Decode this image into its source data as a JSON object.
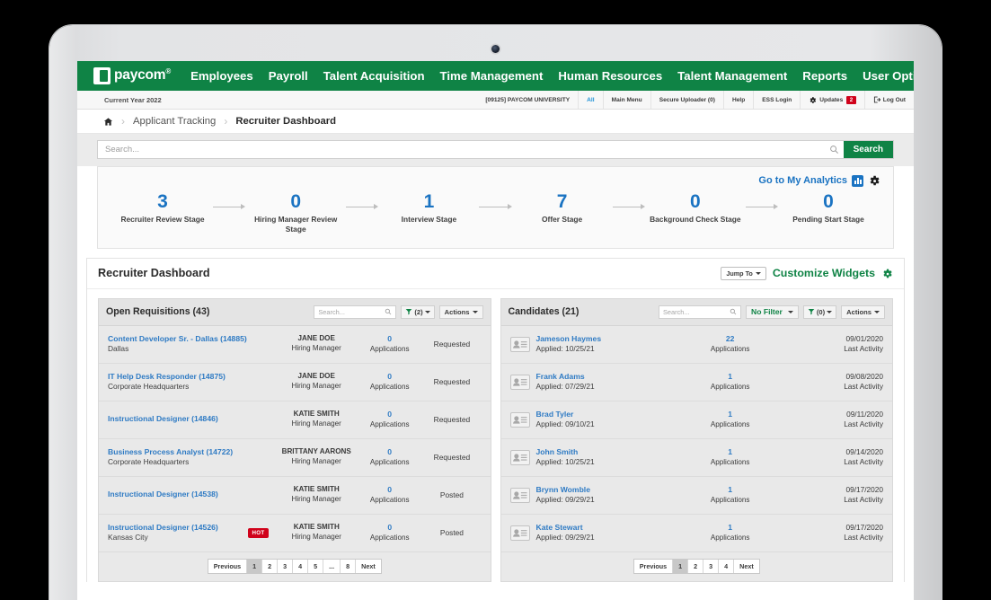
{
  "topnav": {
    "brand": "paycom",
    "brand_tm": "®",
    "items": [
      {
        "label": "Employees"
      },
      {
        "label": "Payroll"
      },
      {
        "label": "Talent Acquisition"
      },
      {
        "label": "Time Management"
      },
      {
        "label": "Human Resources"
      },
      {
        "label": "Talent Management"
      },
      {
        "label": "Reports"
      },
      {
        "label": "User Options"
      }
    ]
  },
  "utilbar": {
    "current_year": "Current Year 2022",
    "client": "[09125] PAYCOM UNIVERSITY",
    "all": "All",
    "main_menu": "Main Menu",
    "secure_uploader": "Secure Uploader (0)",
    "help": "Help",
    "ess_login": "ESS Login",
    "updates": "Updates",
    "updates_count": "2",
    "log_out": "Log Out"
  },
  "breadcrumb": {
    "home_icon": "home-icon",
    "items": [
      "Applicant Tracking",
      "Recruiter Dashboard"
    ]
  },
  "search": {
    "placeholder": "Search...",
    "value": "",
    "button_label": "Search"
  },
  "pipeline": {
    "analytics_link": "Go to My Analytics",
    "stages": [
      {
        "count": "3",
        "label": "Recruiter Review Stage"
      },
      {
        "count": "0",
        "label": "Hiring Manager Review Stage"
      },
      {
        "count": "1",
        "label": "Interview Stage"
      },
      {
        "count": "7",
        "label": "Offer Stage"
      },
      {
        "count": "0",
        "label": "Background Check Stage"
      },
      {
        "count": "0",
        "label": "Pending Start Stage"
      }
    ]
  },
  "dashboard": {
    "title": "Recruiter Dashboard",
    "jump_to": "Jump To",
    "customize_widgets": "Customize Widgets"
  },
  "requisitions": {
    "title": "Open Requisitions (43)",
    "search_placeholder": "Search...",
    "filter_label": "(2)",
    "actions_label": "Actions",
    "rows": [
      {
        "title": "Content Developer Sr. - Dallas (14885)",
        "location": "Dallas",
        "hot": "",
        "manager": "JANE DOE",
        "role": "Hiring Manager",
        "apps": "0",
        "apps_label": "Applications",
        "status": "Requested"
      },
      {
        "title": "IT Help Desk Responder (14875)",
        "location": "Corporate Headquarters",
        "hot": "",
        "manager": "JANE DOE",
        "role": "Hiring Manager",
        "apps": "0",
        "apps_label": "Applications",
        "status": "Requested"
      },
      {
        "title": "Instructional Designer (14846)",
        "location": "",
        "hot": "",
        "manager": "KATIE SMITH",
        "role": "Hiring Manager",
        "apps": "0",
        "apps_label": "Applications",
        "status": "Requested"
      },
      {
        "title": "Business Process Analyst (14722)",
        "location": "Corporate Headquarters",
        "hot": "",
        "manager": "BRITTANY AARONS",
        "role": "Hiring Manager",
        "apps": "0",
        "apps_label": "Applications",
        "status": "Requested"
      },
      {
        "title": "Instructional Designer (14538)",
        "location": "",
        "hot": "",
        "manager": "KATIE SMITH",
        "role": "Hiring Manager",
        "apps": "0",
        "apps_label": "Applications",
        "status": "Posted"
      },
      {
        "title": "Instructional Designer (14526)",
        "location": "Kansas City",
        "hot": "HOT",
        "manager": "KATIE SMITH",
        "role": "Hiring Manager",
        "apps": "0",
        "apps_label": "Applications",
        "status": "Posted"
      }
    ],
    "pager": [
      "Previous",
      "1",
      "2",
      "3",
      "4",
      "5",
      "...",
      "8",
      "Next"
    ],
    "pager_active": "1"
  },
  "candidates": {
    "title": "Candidates (21)",
    "search_placeholder": "Search...",
    "no_filter_label": "No Filter",
    "filter_label": "(0)",
    "actions_label": "Actions",
    "rows": [
      {
        "name": "Jameson Haymes",
        "applied": "Applied: 10/25/21",
        "apps": "22",
        "apps_label": "Applications",
        "date": "09/01/2020",
        "date_label": "Last Activity"
      },
      {
        "name": "Frank Adams",
        "applied": "Applied: 07/29/21",
        "apps": "1",
        "apps_label": "Applications",
        "date": "09/08/2020",
        "date_label": "Last Activity"
      },
      {
        "name": "Brad Tyler",
        "applied": "Applied: 09/10/21",
        "apps": "1",
        "apps_label": "Applications",
        "date": "09/11/2020",
        "date_label": "Last Activity"
      },
      {
        "name": "John Smith",
        "applied": "Applied: 10/25/21",
        "apps": "1",
        "apps_label": "Applications",
        "date": "09/14/2020",
        "date_label": "Last Activity"
      },
      {
        "name": "Brynn Womble",
        "applied": "Applied: 09/29/21",
        "apps": "1",
        "apps_label": "Applications",
        "date": "09/17/2020",
        "date_label": "Last Activity"
      },
      {
        "name": "Kate Stewart",
        "applied": "Applied: 09/29/21",
        "apps": "1",
        "apps_label": "Applications",
        "date": "09/17/2020",
        "date_label": "Last Activity"
      }
    ],
    "pager": [
      "Previous",
      "1",
      "2",
      "3",
      "4",
      "Next"
    ],
    "pager_active": "1"
  },
  "colors": {
    "brand_green": "#0f8345",
    "link_blue": "#2f7bc4",
    "accent_blue": "#1a73c2",
    "badge_red": "#d0021b"
  }
}
